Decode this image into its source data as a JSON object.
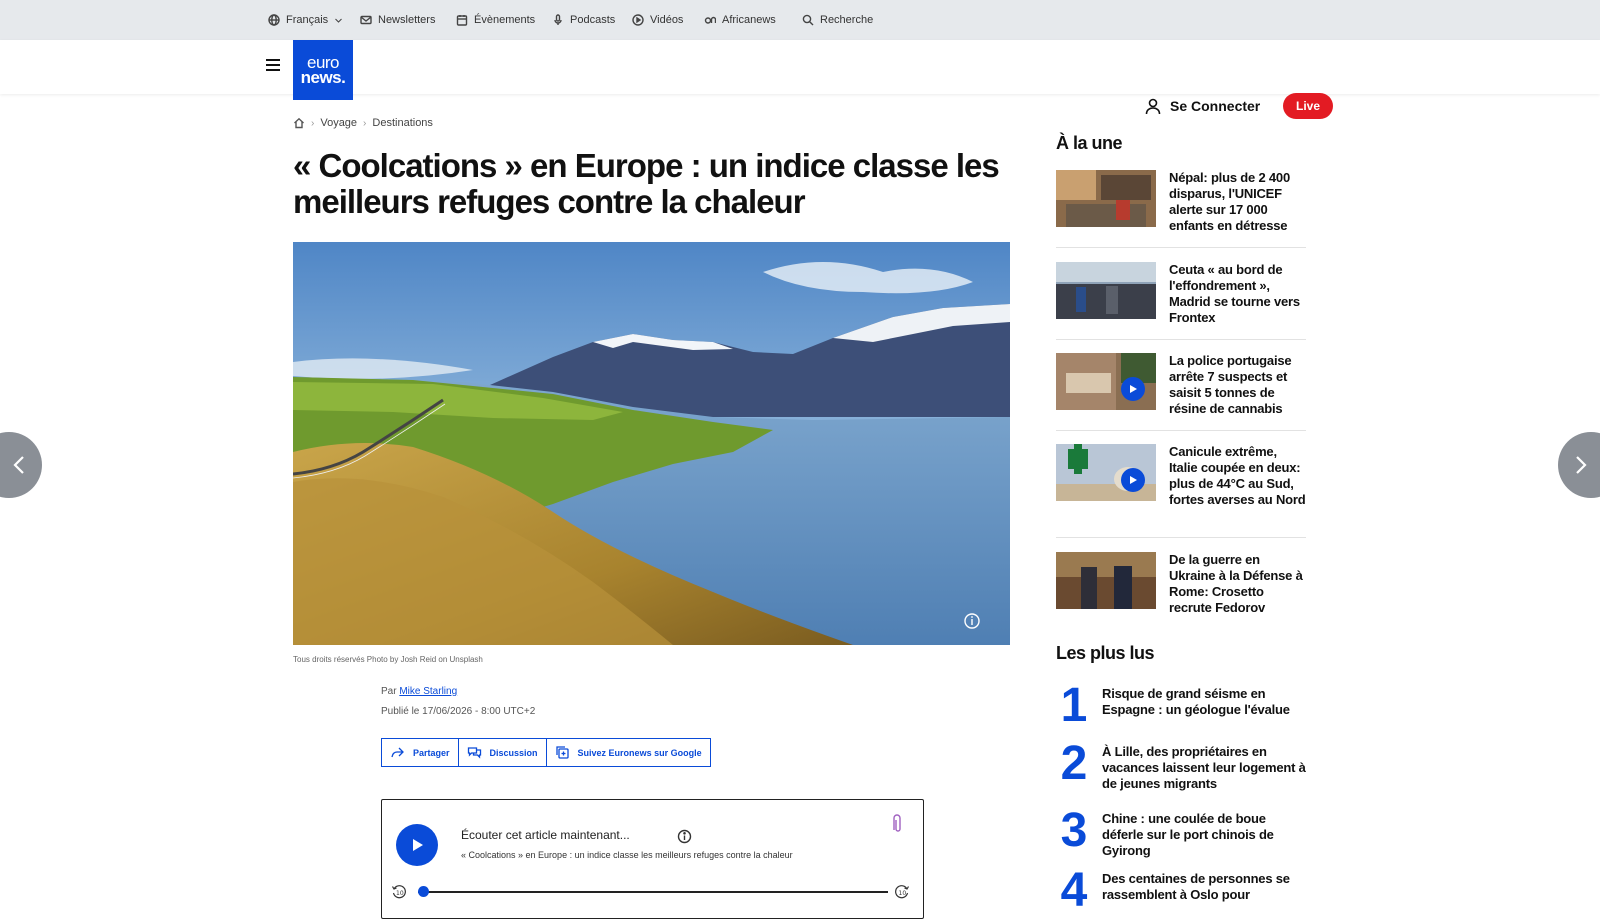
{
  "util_bar": {
    "language": "Français",
    "newsletters": "Newsletters",
    "events": "Évènements",
    "podcasts": "Podcasts",
    "videos": "Vidéos",
    "africanews": "Africanews",
    "search": "Recherche"
  },
  "header": {
    "logo_line1": "euro",
    "logo_line2": "news.",
    "login": "Se Connecter",
    "live": "Live"
  },
  "breadcrumb": [
    "Voyage",
    "Destinations"
  ],
  "article": {
    "title": "« Coolcations » en Europe : un indice classe les meilleurs refuges contre la chaleur",
    "caption": "Tous droits réservés Photo by Josh Reid on Unsplash",
    "by_prefix": "Par",
    "author": "Mike Starling",
    "published": "Publié le 17/06/2026 - 8:00 UTC+2",
    "actions": {
      "share": "Partager",
      "discussion": "Discussion",
      "follow": "Suivez Euronews sur Google"
    },
    "player": {
      "title": "Écouter cet article maintenant...",
      "subtitle": "« Coolcations » en Europe : un indice classe les meilleurs refuges contre la chaleur"
    }
  },
  "sidebar": {
    "top_heading": "À la une",
    "top_stories": [
      {
        "headline": "Népal: plus de 2 400 disparus, l'UNICEF alerte sur 17 000 enfants en détresse"
      },
      {
        "headline": "Ceuta « au bord de l'effondrement », Madrid se tourne vers Frontex"
      },
      {
        "headline": "La police portugaise arrête 7 suspects et saisit 5 tonnes de résine de cannabis"
      },
      {
        "headline": "Canicule extrême, Italie coupée en deux: plus de 44°C au Sud, fortes averses au Nord"
      },
      {
        "headline": "De la guerre en Ukraine à la Défense à Rome: Crosetto recrute Fedorov"
      }
    ],
    "most_read_heading": "Les plus lus",
    "most_read": [
      {
        "rank": "1",
        "headline": "Risque de grand séisme en Espagne : un géologue l'évalue"
      },
      {
        "rank": "2",
        "headline": "À Lille, des propriétaires en vacances laissent leur logement à de jeunes migrants"
      },
      {
        "rank": "3",
        "headline": "Chine : une coulée de boue déferle sur le port chinois de Gyirong"
      },
      {
        "rank": "4",
        "headline": "Des centaines de personnes se rassemblent à Oslo pour"
      }
    ]
  }
}
